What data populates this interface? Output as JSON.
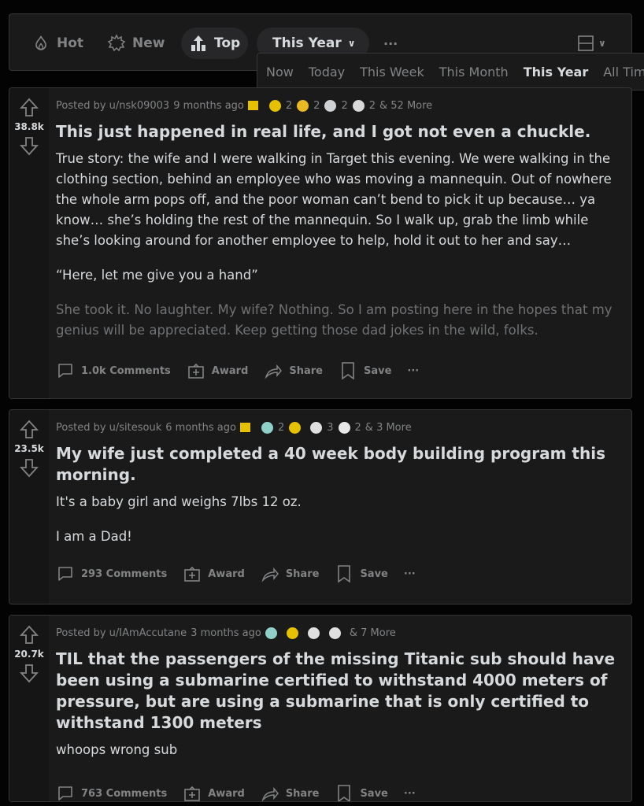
{
  "sort": {
    "hot": "Hot",
    "new": "New",
    "top": "Top",
    "time": "This Year",
    "more": "···"
  },
  "time_menu": [
    "Now",
    "Today",
    "This Week",
    "This Month",
    "This Year",
    "All Time"
  ],
  "posts": [
    {
      "score": "38.8k",
      "author": "Posted by u/nsk09003",
      "age": "9 months ago",
      "awards": [
        "2",
        "2",
        "2",
        "2"
      ],
      "more": "& 52 More",
      "title": "This just happened in real life, and I got not even a chuckle.",
      "body": [
        "True story: the wife and I were walking in Target this evening. We were walking in the clothing section, behind an employee who was moving a mannequin. Out of nowhere the whole arm pops off, and the poor woman can’t bend to pick it up because… ya know… she’s holding the rest of the mannequin. So I walk up, grab the limb while she’s looking around for another employee to help, hold it out to her and say…",
        "“Here, let me give you a hand”",
        "She took it. No laughter. My wife? Nothing. So I am posting here in the hopes that my genius will be appreciated. Keep getting those dad jokes in the wild, folks."
      ],
      "comments": "1.0k Comments"
    },
    {
      "score": "23.5k",
      "author": "Posted by u/sitesouk",
      "age": "6 months ago",
      "awards": [
        "2",
        "",
        "3",
        "2"
      ],
      "more": "& 3 More",
      "title": "My wife just completed a 40 week body building program this morning.",
      "body": [
        "It's a baby girl and weighs 7lbs 12 oz.",
        "I am a Dad!"
      ],
      "comments": "293 Comments"
    },
    {
      "score": "20.7k",
      "author": "Posted by u/IAmAccutane",
      "age": "3 months ago",
      "awards": [
        "",
        "",
        "",
        ""
      ],
      "more": "& 7 More",
      "title": "TIL that the passengers of the missing Titanic sub should have been using a submarine certified to withstand 4000 meters of pressure, but are using a submarine that is only certified to withstand 1300 meters",
      "body": [
        "whoops wrong sub"
      ],
      "comments": "763 Comments"
    }
  ],
  "actions": {
    "award": "Award",
    "share": "Share",
    "save": "Save",
    "more": "···"
  },
  "colors": {
    "background": "#030303",
    "card": "#1a1a1b",
    "text": "#d7dadc",
    "muted": "#818384",
    "award_gold": "#e5c100"
  }
}
